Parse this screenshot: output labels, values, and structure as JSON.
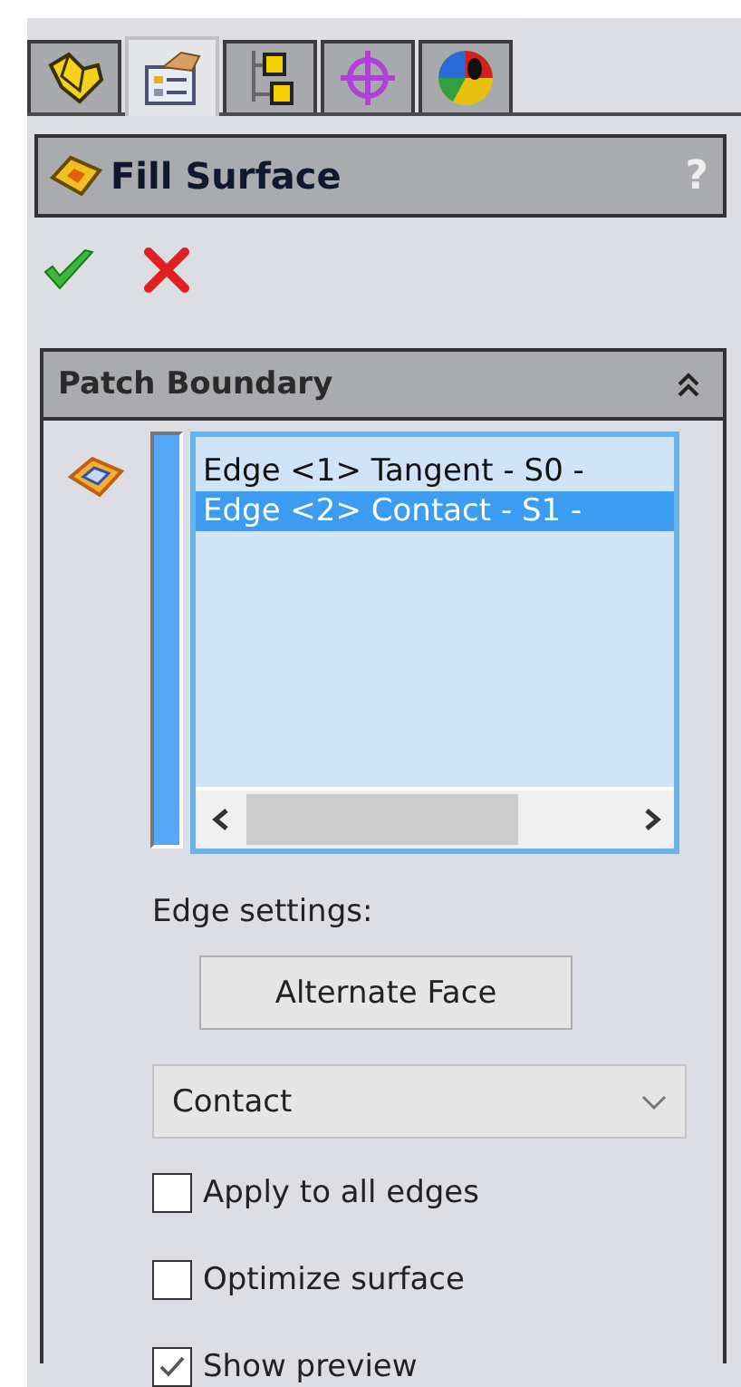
{
  "tabs": [
    {
      "kind": "part",
      "selected": false
    },
    {
      "kind": "property",
      "selected": true
    },
    {
      "kind": "config",
      "selected": false
    },
    {
      "kind": "target",
      "selected": false
    },
    {
      "kind": "appearance",
      "selected": false
    }
  ],
  "title_bar": {
    "title": "Fill Surface",
    "help": "?"
  },
  "section": {
    "title": "Patch Boundary",
    "expanded": true,
    "edges": [
      {
        "label": "Edge <1> Tangent - S0 -",
        "selected": false
      },
      {
        "label": "Edge <2> Contact - S1 -",
        "selected": true
      }
    ],
    "edge_settings_label": "Edge settings:",
    "alternate_button": "Alternate Face",
    "dropdown": {
      "value": "Contact"
    },
    "options": [
      {
        "label": "Apply to all edges",
        "checked": false
      },
      {
        "label": "Optimize surface",
        "checked": false
      },
      {
        "label": "Show preview",
        "checked": true
      }
    ]
  }
}
